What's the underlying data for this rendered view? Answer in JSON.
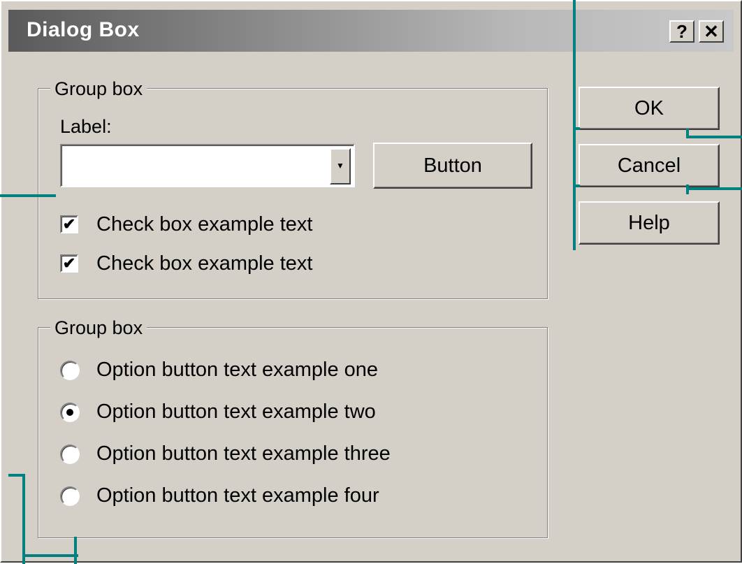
{
  "dialog": {
    "title": "Dialog Box",
    "help_button": "?",
    "close_button": "✕"
  },
  "group1": {
    "label": "Group box",
    "field_label": "Label:",
    "combo_value": "",
    "button_label": "Button",
    "checkboxes": [
      {
        "label": "Check box example text",
        "checked": true
      },
      {
        "label": "Check box example text",
        "checked": true
      }
    ]
  },
  "group2": {
    "label": "Group box",
    "options": [
      {
        "label": "Option button text example one",
        "selected": false
      },
      {
        "label": "Option button text example two",
        "selected": true
      },
      {
        "label": "Option button text example three",
        "selected": false
      },
      {
        "label": "Option button text example four",
        "selected": false
      }
    ]
  },
  "buttons": {
    "ok": "OK",
    "cancel": "Cancel",
    "help": "Help"
  },
  "colors": {
    "face": "#d4d0c8",
    "callout": "#00807f"
  }
}
